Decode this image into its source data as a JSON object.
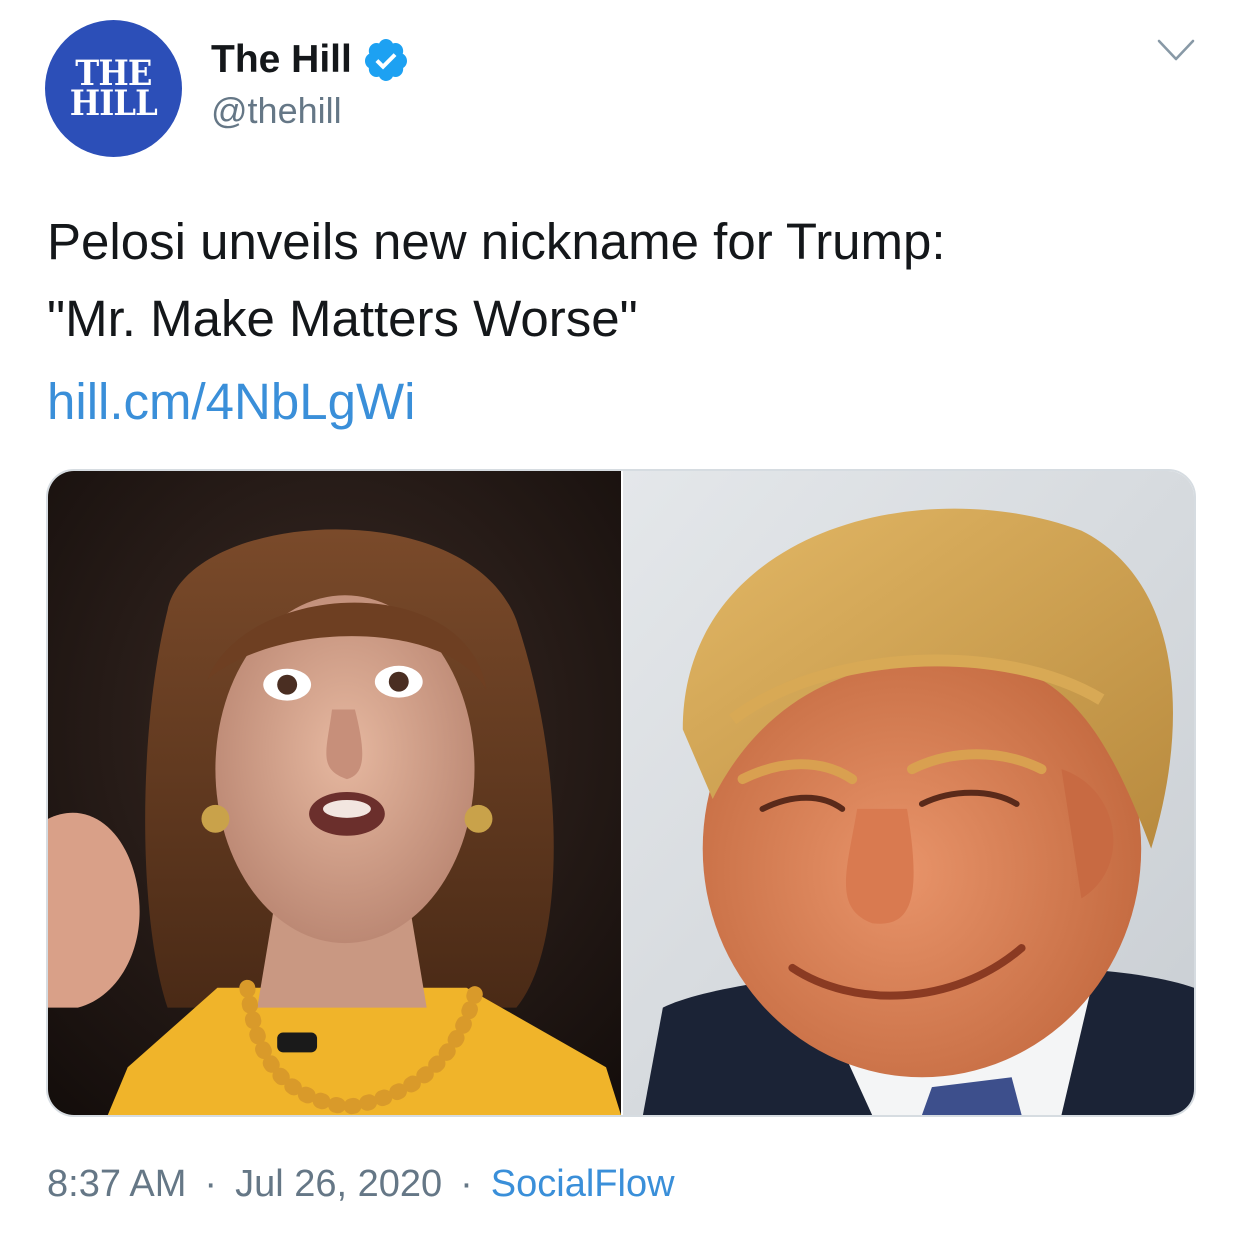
{
  "account": {
    "avatar_lines": [
      "THE",
      "HILL"
    ],
    "display_name": "The Hill",
    "handle": "@thehill",
    "verified": true,
    "avatar_color": "#2c4fb8",
    "verified_color": "#1da1f2"
  },
  "tweet": {
    "text_lines": [
      "Pelosi unveils new nickname for Trump:",
      "\"Mr. Make Matters Worse\""
    ],
    "link": "hill.cm/4NbLgWi",
    "time": "8:37 AM",
    "date": "Jul 26, 2020",
    "separator": "·",
    "source": "SocialFlow",
    "link_color": "#3a8fd9"
  },
  "media": {
    "photos": [
      {
        "subject": "woman-speaking-photo"
      },
      {
        "subject": "man-smiling-photo"
      }
    ]
  },
  "icons": {
    "menu": "chevron-down-icon",
    "verified": "verified-badge-icon"
  }
}
